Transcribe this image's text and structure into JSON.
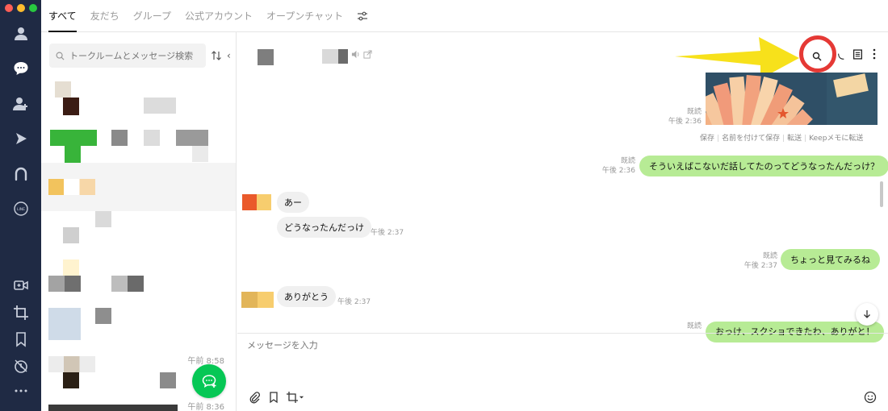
{
  "tabs": [
    {
      "label": "すべて",
      "active": true
    },
    {
      "label": "友だち",
      "active": false
    },
    {
      "label": "グループ",
      "active": false
    },
    {
      "label": "公式アカウント",
      "active": false
    },
    {
      "label": "オープンチャット",
      "active": false
    }
  ],
  "search": {
    "placeholder": "トークルームとメッセージ検索"
  },
  "chat_list": {
    "times": [
      "午前 8:58",
      "午前 8:36"
    ]
  },
  "image_message": {
    "read": "既読",
    "time": "午後 2:36",
    "actions": [
      "保存",
      "名前を付けて保存",
      "転送",
      "Keepメモに転送"
    ]
  },
  "messages": [
    {
      "side": "mine",
      "text": "そういえばこないだ話してたのってどうなったんだっけ？",
      "read": "既読",
      "time": "午後 2:36"
    },
    {
      "side": "other",
      "text": "あー",
      "time": ""
    },
    {
      "side": "other",
      "text": "どうなったんだっけ",
      "time": "午後 2:37"
    },
    {
      "side": "mine",
      "text": "ちょっと見てみるね",
      "read": "既読",
      "time": "午後 2:37"
    },
    {
      "side": "other",
      "text": "ありがとう",
      "time": "午後 2:37"
    },
    {
      "side": "mine",
      "text": "おっけ、スクショできたわ、ありがと！",
      "read": "既読",
      "time": ""
    }
  ],
  "compose": {
    "placeholder": "メッセージを入力"
  },
  "colors": {
    "rail_bg": "#1f2a44",
    "line_green": "#06c755",
    "bubble_green": "#b7eb95",
    "annotation_yellow": "#f7e11b",
    "annotation_red": "#e53935"
  },
  "icons": {
    "rail": [
      "person-icon",
      "chat-bubble-icon",
      "add-friend-icon",
      "play-icon",
      "square-app-icon",
      "line-logo-icon",
      "video-call-icon",
      "crop-icon",
      "bookmark-icon",
      "clock-icon",
      "more-icon"
    ],
    "header": [
      "search-icon",
      "notes-icon",
      "more-vertical-icon"
    ]
  }
}
